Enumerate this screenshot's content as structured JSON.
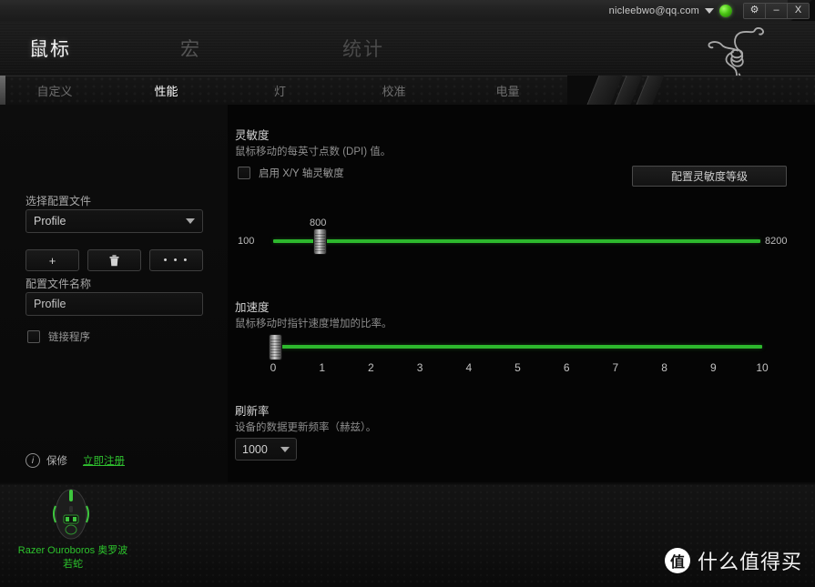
{
  "titlebar": {
    "account": "nicleebwo@qq.com",
    "caret_icon": "chevron-down-icon",
    "status_icon": "online-status-dot",
    "settings_label": "⚙",
    "minimize_label": "–",
    "close_label": "X"
  },
  "header": {
    "main_tabs": [
      {
        "label": "鼠标",
        "active": true
      },
      {
        "label": "宏",
        "active": false
      },
      {
        "label": "统计",
        "active": false
      }
    ],
    "logo_icon": "razer-triple-snake-logo"
  },
  "subtabs": [
    {
      "label": "自定义",
      "active": false
    },
    {
      "label": "性能",
      "active": true
    },
    {
      "label": "灯",
      "active": false
    },
    {
      "label": "校准",
      "active": false
    },
    {
      "label": "电量",
      "active": false
    }
  ],
  "sidebar": {
    "profile_select_label": "选择配置文件",
    "profile_select_value": "Profile",
    "add_button": "+",
    "delete_button": "🗑",
    "more_button": "• • •",
    "profile_name_label": "配置文件名称",
    "profile_name_value": "Profile",
    "link_program_label": "链接程序",
    "link_program_checked": false,
    "warranty_label": "保修",
    "register_link": "立即注册",
    "info_icon": "info-icon"
  },
  "sensitivity": {
    "title": "灵敏度",
    "desc": "鼠标移动的每英寸点数 (DPI) 值。",
    "xy_checkbox_label": "启用 X/Y 轴灵敏度",
    "xy_checked": false,
    "configure_button": "配置灵敏度等级",
    "min_label": "100",
    "max_label": "8200",
    "value_label": "800"
  },
  "acceleration": {
    "title": "加速度",
    "desc": "鼠标移动时指针速度增加的比率。",
    "ticks": [
      "0",
      "1",
      "2",
      "3",
      "4",
      "5",
      "6",
      "7",
      "8",
      "9",
      "10"
    ],
    "value": 0
  },
  "polling": {
    "title": "刷新率",
    "desc": "设备的数据更新频率（赫兹）。",
    "value": "1000"
  },
  "device": {
    "name_line1": "Razer Ouroboros 奥罗波",
    "name_line2": "若蛇",
    "icon": "razer-ouroboros-mouse-icon"
  },
  "watermark": {
    "badge": "值",
    "text": "什么值得买"
  },
  "colors": {
    "accent_green": "#2db82d",
    "link_green": "#2fc12f",
    "device_green": "#2cc22c"
  }
}
